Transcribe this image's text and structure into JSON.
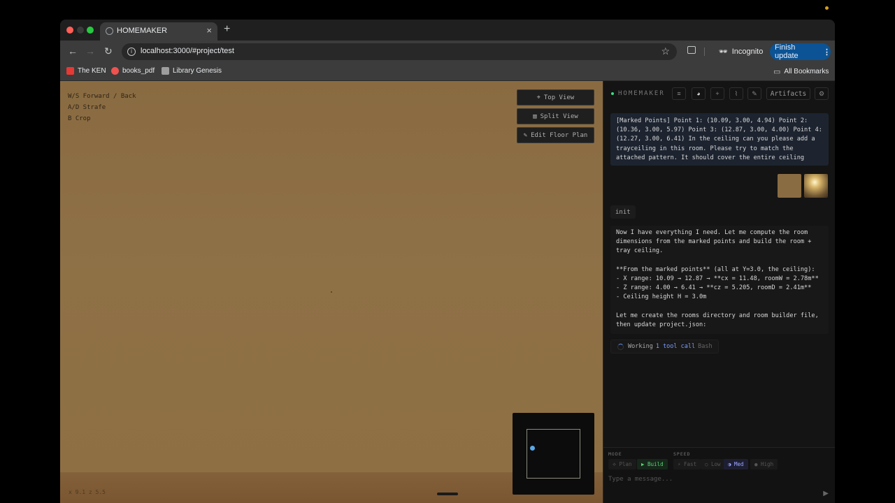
{
  "browser": {
    "tab_title": "HOMEMAKER",
    "url": "localhost:3000/#project/test",
    "incognito_label": "Incognito",
    "finish_update_label": "Finish update",
    "bookmarks": [
      {
        "label": "The KEN",
        "color": "#e53935"
      },
      {
        "label": "books_pdf",
        "color": "#ef5350"
      },
      {
        "label": "Library Genesis",
        "color": "#9e9e9e"
      }
    ],
    "all_bookmarks_label": "All Bookmarks"
  },
  "viewport": {
    "hints": [
      "W/S Forward / Back",
      "A/D Strafe",
      "B Crop"
    ],
    "buttons": {
      "top_view": "Top View",
      "split_view": "Split View",
      "edit_floor_plan": "Edit Floor Plan"
    },
    "coords": "x 9.1 z 5.5"
  },
  "panel": {
    "brand": "HOMEMAKER",
    "artifacts_label": "Artifacts",
    "user_message": "[Marked Points] Point 1: (10.09, 3.00, 4.94) Point 2: (10.36, 3.00, 5.97) Point 3: (12.87, 3.00, 4.00) Point 4: (12.27, 3.00, 6.41) In the ceiling can you please add a trayceiling in this room. Please try to match the attached pattern. It should cover the entire ceiling",
    "init_label": "init",
    "assistant_message": "Now I have everything I need. Let me compute the room dimensions from the marked points and build the room + tray ceiling.\n\n**From the marked points** (all at Y=3.0, the ceiling):\n- X range: 10.09 → 12.87 → **cx = 11.48, roomW = 2.78m**\n- Z range: 4.00 → 6.41 → **cz = 5.205, roomD = 2.41m**\n- Ceiling height H = 3.0m\n\nLet me create the rooms directory and room builder file, then update project.json:",
    "working": {
      "label": "Working",
      "count": "1 tool call",
      "tool": "Bash"
    },
    "mode": {
      "label": "MODE",
      "options": [
        "⟡ Plan",
        "▶ Build"
      ],
      "selected": "▶ Build"
    },
    "speed": {
      "label": "SPEED",
      "options": [
        "⚡ Fast",
        "○ Low",
        "◑ Med",
        "● High"
      ],
      "selected": "◑ Med"
    },
    "input_placeholder": "Type a message..."
  },
  "colors": {
    "accent_green": "#3ddc84",
    "accent_blue": "#0b5394",
    "wall": "#8c6e44"
  }
}
